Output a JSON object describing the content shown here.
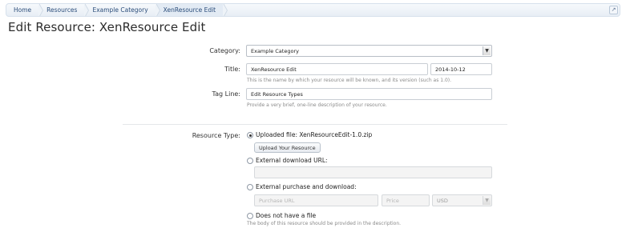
{
  "breadcrumb": [
    {
      "label": "Home"
    },
    {
      "label": "Resources"
    },
    {
      "label": "Example Category"
    },
    {
      "label": "XenResource Edit"
    }
  ],
  "breadcrumb_jump_icon": "jump-arrow-icon",
  "page": {
    "title": "Edit Resource: XenResource Edit"
  },
  "form": {
    "category": {
      "label": "Category:",
      "value": "Example Category"
    },
    "title": {
      "label": "Title:",
      "value": "XenResource Edit",
      "version": "2014-10-12",
      "hint": "This is the name by which your resource will be known, and its version (such as 1.0)."
    },
    "tagline": {
      "label": "Tag Line:",
      "value": "Edit Resource Types",
      "hint": "Provide a very brief, one-line description of your resource."
    },
    "resource_type": {
      "label": "Resource Type:",
      "uploaded": {
        "label": "Uploaded file: XenResourceEdit-1.0.zip",
        "button": "Upload Your Resource",
        "checked": true
      },
      "external_url": {
        "label": "External download URL:",
        "value": "",
        "checked": false
      },
      "external_purchase": {
        "label": "External purchase and download:",
        "url_placeholder": "Purchase URL",
        "price_placeholder": "Price",
        "currency": "USD",
        "checked": false
      },
      "no_file": {
        "label": "Does not have a file",
        "hint": "The body of this resource should be provided in the description.",
        "checked": false
      }
    }
  }
}
